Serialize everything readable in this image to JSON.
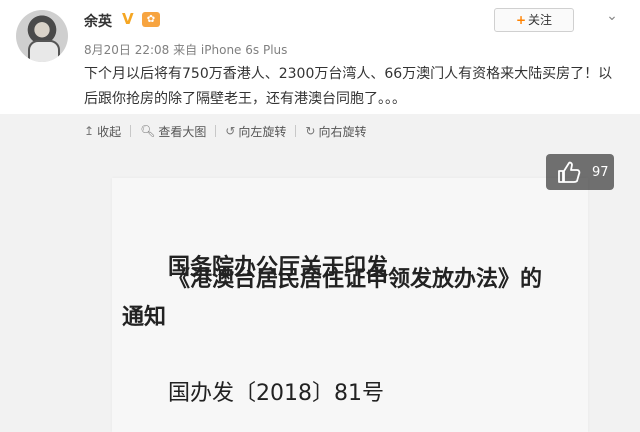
{
  "user": {
    "name": "余英",
    "verified_badge": "V",
    "level_badge": "✿",
    "meta": "8月20日 22:08 来自 iPhone 6s Plus",
    "avatar_icon": "avatar"
  },
  "follow_button": {
    "plus": "+",
    "label": "关注"
  },
  "post": {
    "text": "下个月以后将有750万香港人、2300万台湾人、66万澳门人有资格来大陆买房了！以后跟你抢房的除了隔壁老王，还有港澳台同胞了。。。"
  },
  "toolbar": {
    "items": [
      {
        "icon": "collapse-icon",
        "label": "收起"
      },
      {
        "icon": "zoom-icon",
        "label": "查看大图"
      },
      {
        "icon": "rotate-left-icon",
        "label": "向左旋转"
      },
      {
        "icon": "rotate-right-icon",
        "label": "向右旋转"
      }
    ]
  },
  "document": {
    "line1": "国务院办公厅关于印发",
    "line2": "《港澳台居民居住证申领发放办法》的",
    "line3": "通知",
    "line4": "国办发〔2018〕81号"
  },
  "like": {
    "count": "97",
    "icon": "thumbs-up-icon"
  }
}
